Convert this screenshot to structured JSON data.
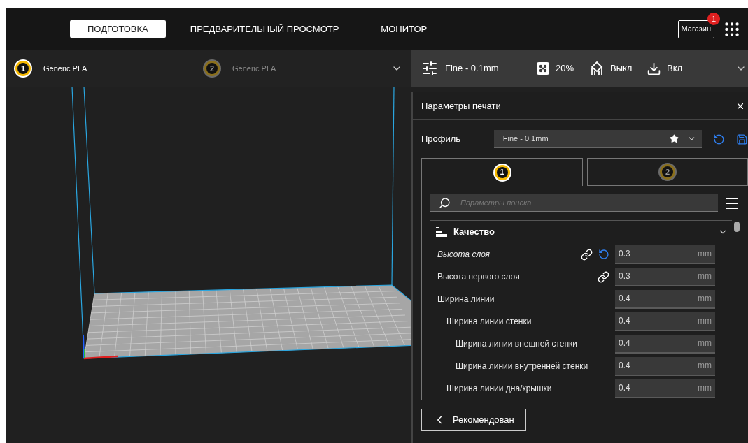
{
  "tabs": [
    {
      "label": "ПОДГОТОВКА",
      "selected": true
    },
    {
      "label": "ПРЕДВАРИТЕЛЬНЫЙ ПРОСМОТР",
      "selected": false
    },
    {
      "label": "МОНИТОР",
      "selected": false
    }
  ],
  "store": {
    "label": "Магазин",
    "badge": "1"
  },
  "extruders": [
    {
      "number": "1",
      "material": "Generic PLA",
      "selected": true
    },
    {
      "number": "2",
      "material": "Generic PLA",
      "selected": false
    }
  ],
  "print_bar": {
    "profile": "Fine - 0.1mm",
    "infill": "20%",
    "support": "Выкл",
    "adhesion": "Вкл"
  },
  "panel": {
    "title": "Параметры печати",
    "profile_label": "Профиль",
    "profile": "Fine - 0.1mm",
    "extruder_tabs": [
      {
        "number": "1",
        "selected": true
      },
      {
        "number": "2",
        "selected": false
      }
    ],
    "search": {
      "placeholder": "Параметры поиска"
    },
    "category": {
      "title": "Качество",
      "expanded": true,
      "settings": [
        {
          "label": "Высота слоя",
          "value": "0.3",
          "unit": "mm",
          "modified": true,
          "linked": true
        },
        {
          "label": "Высота первого слоя",
          "value": "0.3",
          "unit": "mm",
          "modified": false,
          "linked": true
        },
        {
          "label": "Ширина линии",
          "value": "0.4",
          "unit": "mm",
          "modified": false,
          "linked": false,
          "children": [
            {
              "label": "Ширина линии стенки",
              "value": "0.4",
              "unit": "mm",
              "modified": false,
              "linked": false,
              "children": [
                {
                  "label": "Ширина линии внешней стенки",
                  "value": "0.4",
                  "unit": "mm",
                  "modified": false,
                  "linked": false
                },
                {
                  "label": "Ширина линии внутренней стенки",
                  "value": "0.4",
                  "unit": "mm",
                  "modified": false,
                  "linked": false
                }
              ]
            },
            {
              "label": "Ширина линии дна/крышки",
              "value": "0.4",
              "unit": "mm",
              "modified": false,
              "linked": false
            }
          ]
        }
      ]
    },
    "recommended_button": "Рекомендован"
  }
}
